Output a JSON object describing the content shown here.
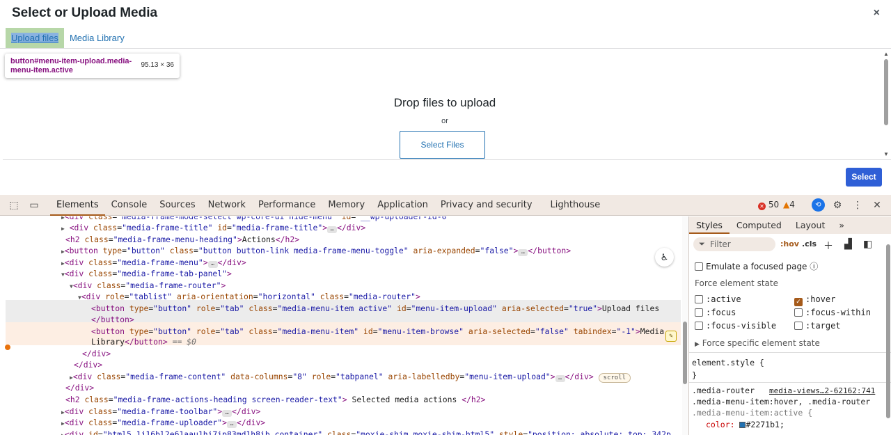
{
  "modal": {
    "title": "Select or Upload Media",
    "close_icon": "×",
    "tabs": [
      "Upload files",
      "Media Library"
    ],
    "tooltip_selector": "button#menu-item-upload.media-menu-item.active",
    "tooltip_size": "95.13 × 36",
    "drop_text": "Drop files to upload",
    "or_text": "or",
    "select_files_label": "Select Files",
    "select_label": "Select"
  },
  "devtools": {
    "tabs": [
      "Elements",
      "Console",
      "Sources",
      "Network",
      "Performance",
      "Memory",
      "Application",
      "Privacy and security",
      "Lighthouse"
    ],
    "errors_count": "50",
    "warnings_count": "4",
    "styles_tabs": [
      "Styles",
      "Computed",
      "Layout"
    ],
    "filter_placeholder": "Filter",
    "hov_label": ":hov",
    "cls_label": ".cls",
    "emulate_focused": "Emulate a focused page",
    "force_state_heading": "Force element state",
    "states": [
      {
        "label": ":active",
        "checked": false
      },
      {
        "label": ":hover",
        "checked": true
      },
      {
        "label": ":focus",
        "checked": false
      },
      {
        "label": ":focus-within",
        "checked": false
      },
      {
        "label": ":focus-visible",
        "checked": false
      },
      {
        "label": ":target",
        "checked": false
      }
    ],
    "force_specific": "Force specific element state",
    "element_style": "element.style {",
    "close_brace": "}",
    "rule_selector_1": ".media-router",
    "rule_source": "media-views…2-62162:741",
    "rule_selector_2": ".media-menu-item:hover, .media-router",
    "rule_selector_3": ".media-menu-item:active {",
    "rule_prop": "color:",
    "rule_value": "#2271b1;",
    "accent_color": "#a55a1a",
    "wp_blue": "#2271b1"
  }
}
